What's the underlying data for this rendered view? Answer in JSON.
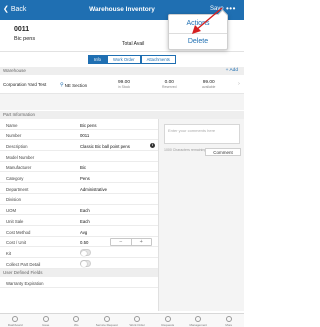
{
  "topbar": {
    "back_label": "Back",
    "title": "Warehouse Inventory",
    "save_label": "Save",
    "more_label": "•••"
  },
  "popover": {
    "actions_label": "Actions",
    "delete_label": "Delete"
  },
  "item": {
    "number": "0011",
    "name": "Bic pens",
    "total_available_label": "Total Avail"
  },
  "tabs": [
    {
      "label": "Info",
      "active": true
    },
    {
      "label": "Work Order",
      "active": false
    },
    {
      "label": "Attachments",
      "active": false
    }
  ],
  "warehouse_section": {
    "title": "Warehouse",
    "add_label": "+ Add",
    "rows": [
      {
        "location": "Corporation Yard Test",
        "section": "NE Section",
        "in_stock_value": "99.00",
        "in_stock_label": "in Stock",
        "reserved_value": "0.00",
        "reserved_label": "Reserved",
        "available_value": "99.00",
        "available_label": "available"
      }
    ]
  },
  "part_info": {
    "title": "Part Information",
    "fields": [
      {
        "label": "Name",
        "value": "Bic pens"
      },
      {
        "label": "Number",
        "value": "0011"
      },
      {
        "label": "Description",
        "value": "Classic Bic ball point pens"
      },
      {
        "label": "Model Number",
        "value": ""
      },
      {
        "label": "Manufacturer",
        "value": "Bic"
      },
      {
        "label": "Category",
        "value": "Pens"
      },
      {
        "label": "Department",
        "value": "Administrative"
      },
      {
        "label": "Division",
        "value": ""
      },
      {
        "label": "UOM",
        "value": "Each"
      },
      {
        "label": "Unit Sale",
        "value": "Each"
      },
      {
        "label": "Cost Method",
        "value": "Avg"
      },
      {
        "label": "Cost / Unit",
        "value": "0.50"
      },
      {
        "label": "Kit",
        "value": ""
      },
      {
        "label": "Collect Part Detail",
        "value": ""
      }
    ]
  },
  "comments": {
    "placeholder": "Enter your comments here",
    "char_remaining": "1000 Characters remaining",
    "comment_button": "Comment"
  },
  "user_defined": {
    "title": "User Defined Fields",
    "first_field": "Warranty Expiration"
  },
  "bottom_nav": [
    "Dashboard",
    "Issue",
    "Wo",
    "Service Request",
    "Work Order",
    "Requests",
    "Management",
    "More"
  ]
}
